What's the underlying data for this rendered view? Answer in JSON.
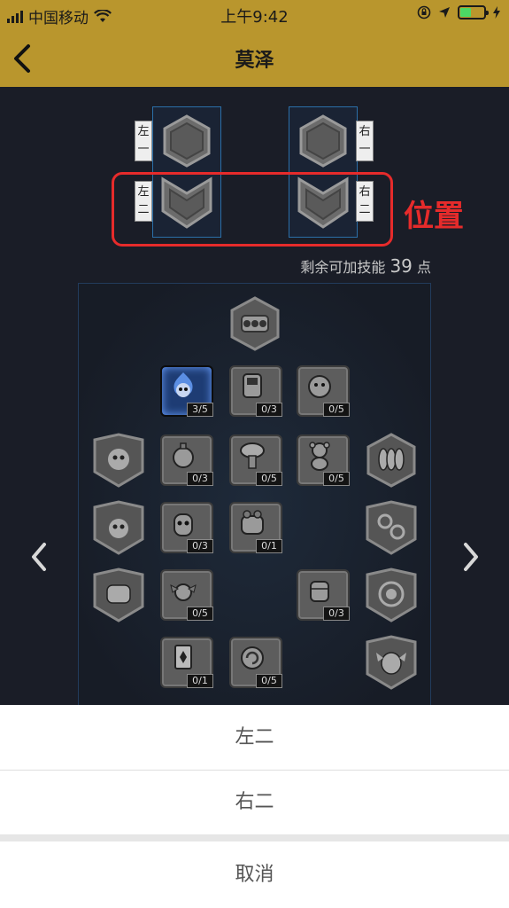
{
  "status_bar": {
    "carrier": "中国移动",
    "time": "上午9:42"
  },
  "nav": {
    "title": "莫泽"
  },
  "positions": {
    "left_one": "左一",
    "left_two": "左二",
    "right_one": "右一",
    "right_two": "右二",
    "annotation": "位置"
  },
  "points": {
    "prefix": "剩余可加技能",
    "value": "39",
    "suffix": "点"
  },
  "skills": [
    {
      "name": "flame-skull-skill",
      "badge": "3/5",
      "active": true
    },
    {
      "name": "robot-skill",
      "badge": "0/3"
    },
    {
      "name": "bear-badge-skill",
      "badge": "0/5"
    },
    {
      "name": "grenade-skill",
      "badge": "0/3"
    },
    {
      "name": "mushroom-cloud-skill",
      "badge": "0/5"
    },
    {
      "name": "teddy-bear-skill",
      "badge": "0/5"
    },
    {
      "name": "skull-grenade-skill",
      "badge": "0/3"
    },
    {
      "name": "robot-pet-skill",
      "badge": "0/1"
    },
    {
      "name": "winged-potion-skill",
      "badge": "0/5"
    },
    {
      "name": "fist-skill",
      "badge": "0/3"
    },
    {
      "name": "card-skill",
      "badge": "0/1"
    },
    {
      "name": "orb-skill",
      "badge": "0/5"
    }
  ],
  "action_sheet": {
    "option_1": "左二",
    "option_2": "右二",
    "cancel": "取消"
  },
  "colors": {
    "header": "#b9962d",
    "background": "#1a1d27",
    "annotation_red": "#e62b2b",
    "slot_border": "#2b6fa8"
  }
}
